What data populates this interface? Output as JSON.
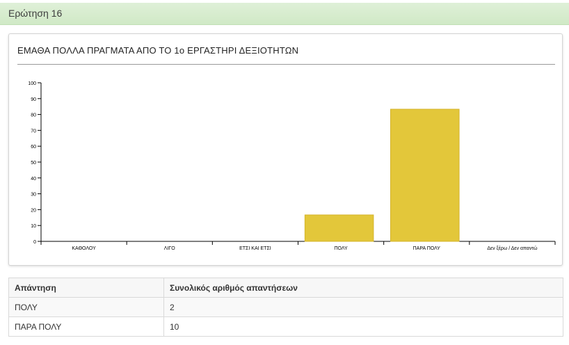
{
  "header": {
    "title": "Ερώτηση 16"
  },
  "chart_data": {
    "type": "bar",
    "title": "ΕΜΑΘΑ ΠΟΛΛΑ ΠΡΑΓΜΑΤΑ ΑΠΟ ΤΟ 1ο ΕΡΓΑΣΤΗΡΙ ΔΕΞΙΟΤΗΤΩΝ",
    "categories": [
      "ΚΑΘΟΛΟΥ",
      "ΛΙΓΟ",
      "ΕΤΣΙ ΚΑΙ ΕΤΣΙ",
      "ΠΟΛΥ",
      "ΠΑΡΑ ΠΟΛΥ",
      "Δεν ξέρω / Δεν απαντώ"
    ],
    "values": [
      0,
      0,
      0,
      16.67,
      83.33,
      0
    ],
    "ylim": [
      0,
      100
    ],
    "yticks": [
      0,
      10,
      20,
      30,
      40,
      50,
      60,
      70,
      80,
      90,
      100
    ],
    "xlabel": "",
    "ylabel": "",
    "grid": false,
    "bar_color": "#e3c73a"
  },
  "table": {
    "headers": [
      "Απάντηση",
      "Συνολικός αριθμός απαντήσεων"
    ],
    "rows": [
      [
        "ΠΟΛΥ",
        "2"
      ],
      [
        "ΠΑΡΑ ΠΟΛΥ",
        "10"
      ]
    ]
  }
}
